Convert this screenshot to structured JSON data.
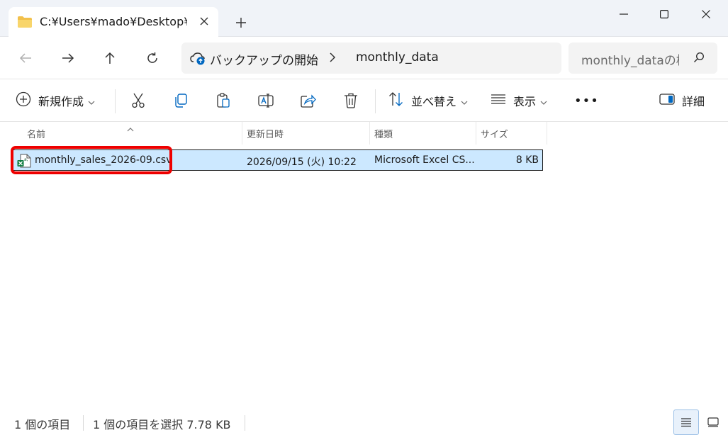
{
  "tab": {
    "title": "C:¥Users¥mado¥Desktop¥",
    "icon": "folder-icon"
  },
  "window": {
    "minimize_icon": "minimize-icon",
    "maximize_icon": "maximize-icon",
    "close_icon": "close-icon"
  },
  "address": {
    "crumbs": [
      "バックアップの開始",
      "monthly_data"
    ]
  },
  "search": {
    "placeholder": "monthly_dataの検索"
  },
  "toolbar": {
    "new_label": "新規作成",
    "sort_label": "並べ替え",
    "view_label": "表示",
    "more_label": "•••",
    "details_label": "詳細"
  },
  "columns": {
    "name": "名前",
    "modified": "更新日時",
    "type": "種類",
    "size": "サイズ"
  },
  "files": [
    {
      "name": "monthly_sales_2026-09.csv",
      "modified": "2026/09/15 (火) 10:22",
      "type": "Microsoft Excel CS...",
      "size": "8 KB",
      "icon": "excel-csv-icon"
    }
  ],
  "status": {
    "count": "1 個の項目",
    "selected": "1 個の項目を選択  7.78 KB"
  },
  "colors": {
    "selection": "#cce8ff",
    "highlight": "#ee0000",
    "accent": "#0067c0"
  }
}
